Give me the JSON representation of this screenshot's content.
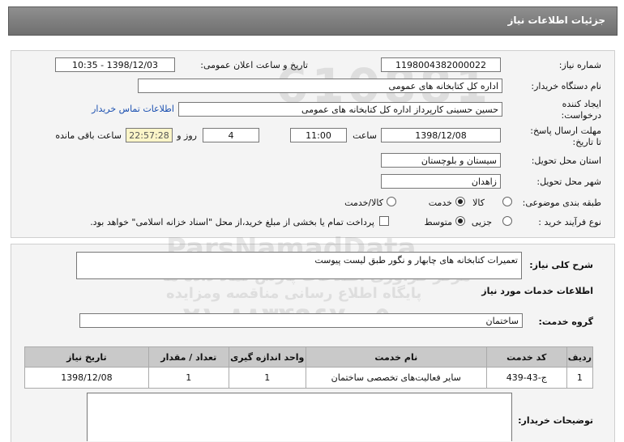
{
  "header": {
    "title": "جزئیات اطلاعات نیاز"
  },
  "form": {
    "need_number_label": "شماره نیاز:",
    "need_number": "1198004382000022",
    "announce_label": "تاریخ و ساعت اعلان عمومی:",
    "announce_value": "1398/12/03 - 10:35",
    "buyer_org_label": "نام دستگاه خریدار:",
    "buyer_org": "اداره کل کتابخانه های عمومی",
    "creator_label_1": "ایجاد کننده",
    "creator_label_2": "درخواست:",
    "creator": "حسین حسینی کارپرداز اداره کل کتابخانه های عمومی",
    "contact_link": "اطلاعات تماس خریدار",
    "deadline_label_1": "مهلت ارسال پاسخ:",
    "deadline_label_2": "تا تاریخ:",
    "deadline_date": "1398/12/08",
    "time_label": "ساعت",
    "deadline_time": "11:00",
    "days_value": "4",
    "days_label": "روز و",
    "remaining_time": "22:57:28",
    "remaining_label": "ساعت باقی مانده",
    "province_label": "استان محل تحویل:",
    "province": "سیستان و بلوچستان",
    "city_label": "شهر محل تحویل:",
    "city": "زاهدان",
    "category_label": "طبقه بندی موضوعی:",
    "category_options": [
      "کالا",
      "خدمت",
      "کالا/خدمت"
    ],
    "category_selected": "خدمت",
    "process_label": "نوع فرآیند خرید :",
    "process_options": [
      "جزیی",
      "متوسط"
    ],
    "process_selected": "متوسط",
    "payment_note": "پرداخت تمام یا بخشی از مبلغ خرید،از محل \"اسناد خزانه اسلامی\" خواهد بود."
  },
  "details": {
    "description_label": "شرح کلی نیاز:",
    "description": "تعمیرات کتابخانه های چابهار و نگور طبق لیست پیوست",
    "services_heading": "اطلاعات خدمات مورد نیاز",
    "service_group_label": "گروه خدمت:",
    "service_group": "ساختمان",
    "table_headers": [
      "ردیف",
      "کد خدمت",
      "نام خدمت",
      "واحد اندازه گیری",
      "تعداد / مقدار",
      "تاریخ نیاز"
    ],
    "table_rows": [
      [
        "1",
        "ج-43-439",
        "سایر فعالیت‌های تخصصی ساختمان",
        "1",
        "1",
        "1398/12/08"
      ]
    ],
    "buyer_notes_label": "توضیحات خریدار:",
    "buyer_notes": ""
  },
  "watermark": {
    "brand": "ParsNamadData",
    "line1": "مرکز فراوری اطلاعات پارس نماد داده ها",
    "line2": "پایگاه اطلاع رسانی مناقصه ومزایده",
    "phone": "۰۲۱-۸۸۳۴۹۶۷۰-۵",
    "digits": "610881"
  }
}
